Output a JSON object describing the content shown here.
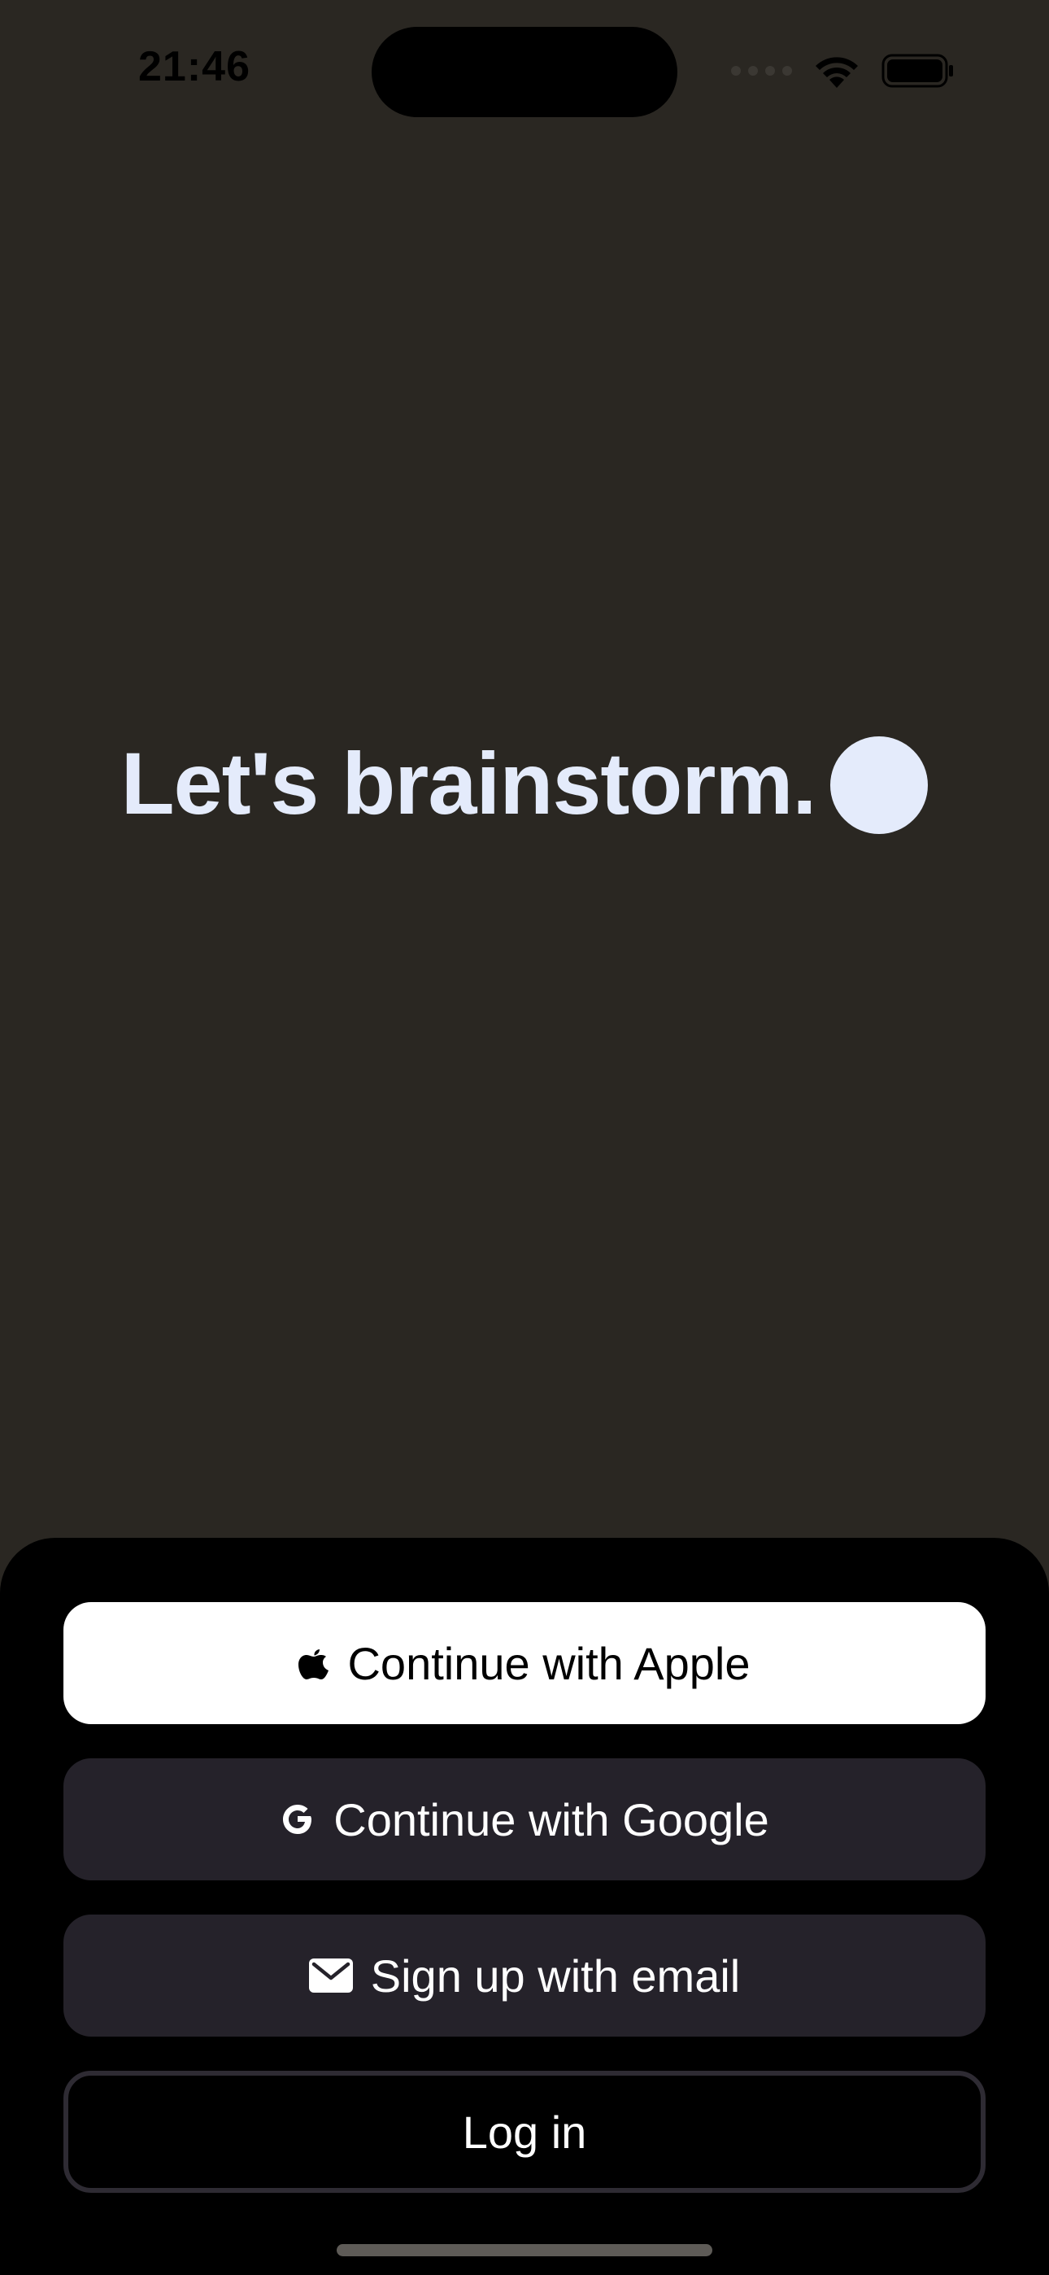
{
  "status_bar": {
    "time": "21:46"
  },
  "hero": {
    "title": "Let's brainstorm."
  },
  "auth": {
    "apple_label": "Continue with Apple",
    "google_label": "Continue with Google",
    "email_label": "Sign up with email",
    "login_label": "Log in"
  },
  "colors": {
    "background": "#2a2722",
    "sheet": "#000000",
    "hero_text": "#e4ebfb",
    "secondary_button": "#25222a",
    "primary_button": "#ffffff"
  },
  "icons": {
    "apple": "apple-icon",
    "google": "google-icon",
    "email": "mail-icon",
    "wifi": "wifi-icon",
    "battery": "battery-icon",
    "signal": "cellular-signal-icon"
  }
}
